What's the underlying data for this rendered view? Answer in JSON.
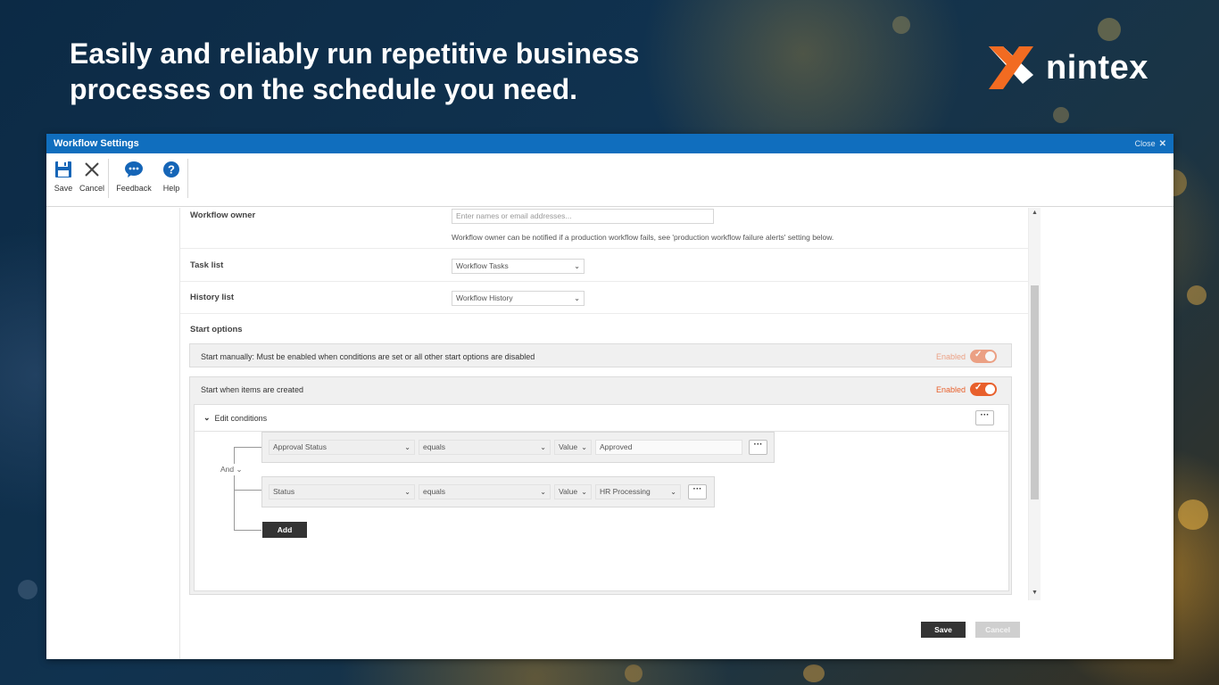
{
  "headline": {
    "line1": "Easily and reliably run repetitive business",
    "line2": "processes on the schedule you need."
  },
  "brand": {
    "name": "nintex",
    "accent_color": "#f26b21"
  },
  "window": {
    "title": "Workflow Settings",
    "close_label": "Close",
    "title_bar_color": "#106ebe"
  },
  "ribbon": {
    "save": "Save",
    "cancel": "Cancel",
    "feedback": "Feedback",
    "help": "Help"
  },
  "form": {
    "workflow_owner": {
      "label": "Workflow owner",
      "placeholder": "Enter names or email addresses...",
      "hint": "Workflow owner can be notified if a production workflow fails, see 'production workflow failure alerts' setting below."
    },
    "task_list": {
      "label": "Task list",
      "value": "Workflow Tasks"
    },
    "history_list": {
      "label": "History list",
      "value": "Workflow History"
    },
    "start_options": {
      "label": "Start options",
      "start_manually": {
        "text": "Start manually: Must be enabled when conditions are set or all other start options are disabled",
        "status": "Enabled"
      },
      "start_created": {
        "text": "Start when items are created",
        "status": "Enabled",
        "edit_conditions": "Edit conditions",
        "operator": "And",
        "conditions": [
          {
            "field": "Approval Status",
            "comparison": "equals",
            "type": "Value",
            "value": "Approved"
          },
          {
            "field": "Status",
            "comparison": "equals",
            "type": "Value",
            "value": "HR Processing"
          }
        ],
        "add_label": "Add"
      }
    }
  },
  "footer": {
    "save": "Save",
    "cancel": "Cancel"
  },
  "colors": {
    "toggle_on": "#e8602c",
    "dark_button": "#333333"
  }
}
